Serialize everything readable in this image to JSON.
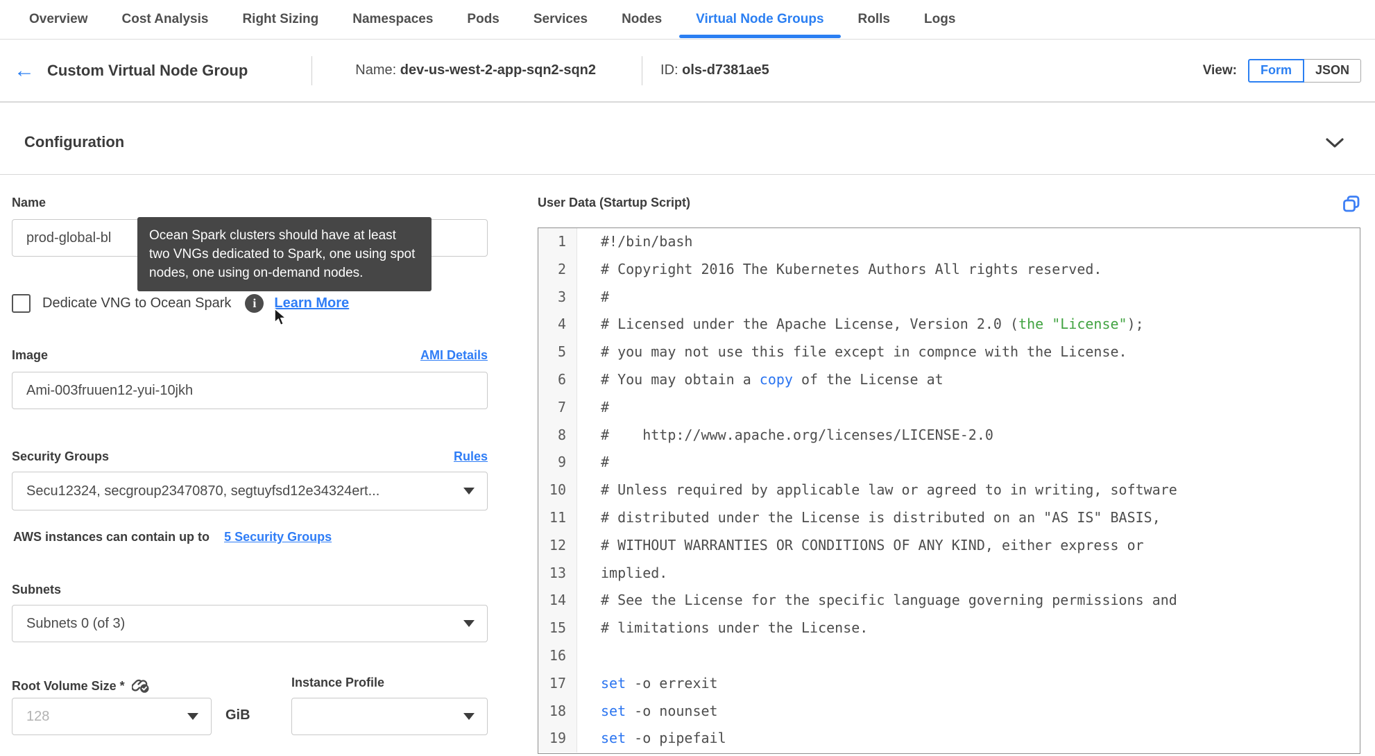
{
  "tabs": [
    "Overview",
    "Cost Analysis",
    "Right Sizing",
    "Namespaces",
    "Pods",
    "Services",
    "Nodes",
    "Virtual Node Groups",
    "Rolls",
    "Logs"
  ],
  "active_tab": "Virtual Node Groups",
  "header": {
    "back_arrow": "←",
    "title": "Custom Virtual Node Group",
    "name_label": "Name:",
    "name_value": "dev-us-west-2-app-sqn2-sqn2",
    "id_label": "ID:",
    "id_value": "ols-d7381ae5",
    "view_label": "View:",
    "view_form": "Form",
    "view_json": "JSON",
    "view_selected": "Form"
  },
  "section": {
    "title": "Configuration",
    "expanded": true
  },
  "form": {
    "name": {
      "label": "Name",
      "value": "prod-global-bl"
    },
    "tooltip": "Ocean Spark clusters should have at least two VNGs dedicated to Spark, one using spot nodes, one using on-demand nodes.",
    "dedicate": {
      "label": "Dedicate VNG to Ocean Spark",
      "checked": false,
      "link": "Learn More"
    },
    "image": {
      "label": "Image",
      "link": "AMI Details",
      "value": "Ami-003fruuen12-yui-10jkh"
    },
    "security_groups": {
      "label": "Security Groups",
      "link": "Rules",
      "value": "Secu12324, secgroup23470870, segtuyfsd12e34324ert...",
      "note_text": "AWS instances can contain up to",
      "note_link": "5 Security Groups"
    },
    "subnets": {
      "label": "Subnets",
      "value": "Subnets 0 (of 3)"
    },
    "root_volume": {
      "label": "Root Volume Size *",
      "placeholder": "128",
      "unit": "GiB"
    },
    "instance_profile": {
      "label": "Instance Profile",
      "value": ""
    }
  },
  "editor": {
    "title": "User Data (Startup Script)",
    "lines": [
      {
        "n": 1,
        "segs": [
          {
            "t": "#!/bin/bash"
          }
        ]
      },
      {
        "n": 2,
        "segs": [
          {
            "t": "# Copyright 2016 The Kubernetes Authors All rights reserved."
          }
        ]
      },
      {
        "n": 3,
        "segs": [
          {
            "t": "#"
          }
        ]
      },
      {
        "n": 4,
        "segs": [
          {
            "t": "# Licensed under the Apache License, Version 2.0 ("
          },
          {
            "t": "the \"License\"",
            "c": "green"
          },
          {
            "t": ");"
          }
        ]
      },
      {
        "n": 5,
        "segs": [
          {
            "t": "# you may not use this file except in compnce with the License."
          }
        ]
      },
      {
        "n": 6,
        "segs": [
          {
            "t": "# You may obtain a "
          },
          {
            "t": "copy",
            "c": "blue"
          },
          {
            "t": " of the License at"
          }
        ]
      },
      {
        "n": 7,
        "segs": [
          {
            "t": "#"
          }
        ]
      },
      {
        "n": 8,
        "segs": [
          {
            "t": "#    http://www.apache.org/licenses/LICENSE-2.0"
          }
        ]
      },
      {
        "n": 9,
        "segs": [
          {
            "t": "#"
          }
        ]
      },
      {
        "n": 10,
        "segs": [
          {
            "t": "# Unless required by applicable law or agreed to in writing, software"
          }
        ]
      },
      {
        "n": 11,
        "segs": [
          {
            "t": "# distributed under the License is distributed on an \"AS IS\" BASIS,"
          }
        ]
      },
      {
        "n": 12,
        "segs": [
          {
            "t": "# WITHOUT WARRANTIES OR CONDITIONS OF ANY KIND, either express or"
          }
        ]
      },
      {
        "n": 13,
        "segs": [
          {
            "t": "implied."
          }
        ]
      },
      {
        "n": 14,
        "segs": [
          {
            "t": "# See the License for the specific language governing permissions and"
          }
        ]
      },
      {
        "n": 15,
        "segs": [
          {
            "t": "# limitations under the License."
          }
        ]
      },
      {
        "n": 16,
        "segs": [
          {
            "t": ""
          }
        ]
      },
      {
        "n": 17,
        "segs": [
          {
            "t": "set",
            "c": "blue"
          },
          {
            "t": " -o errexit"
          }
        ]
      },
      {
        "n": 18,
        "segs": [
          {
            "t": "set",
            "c": "blue"
          },
          {
            "t": " -o nounset"
          }
        ]
      },
      {
        "n": 19,
        "segs": [
          {
            "t": "set",
            "c": "blue"
          },
          {
            "t": " -o pipefail"
          }
        ]
      }
    ]
  },
  "colors": {
    "accent_blue": "#2b7ff2",
    "tooltip_bg": "#464646",
    "code_green": "#41a341",
    "code_blue": "#2a74f0",
    "border_gray": "#c9c9c9"
  }
}
